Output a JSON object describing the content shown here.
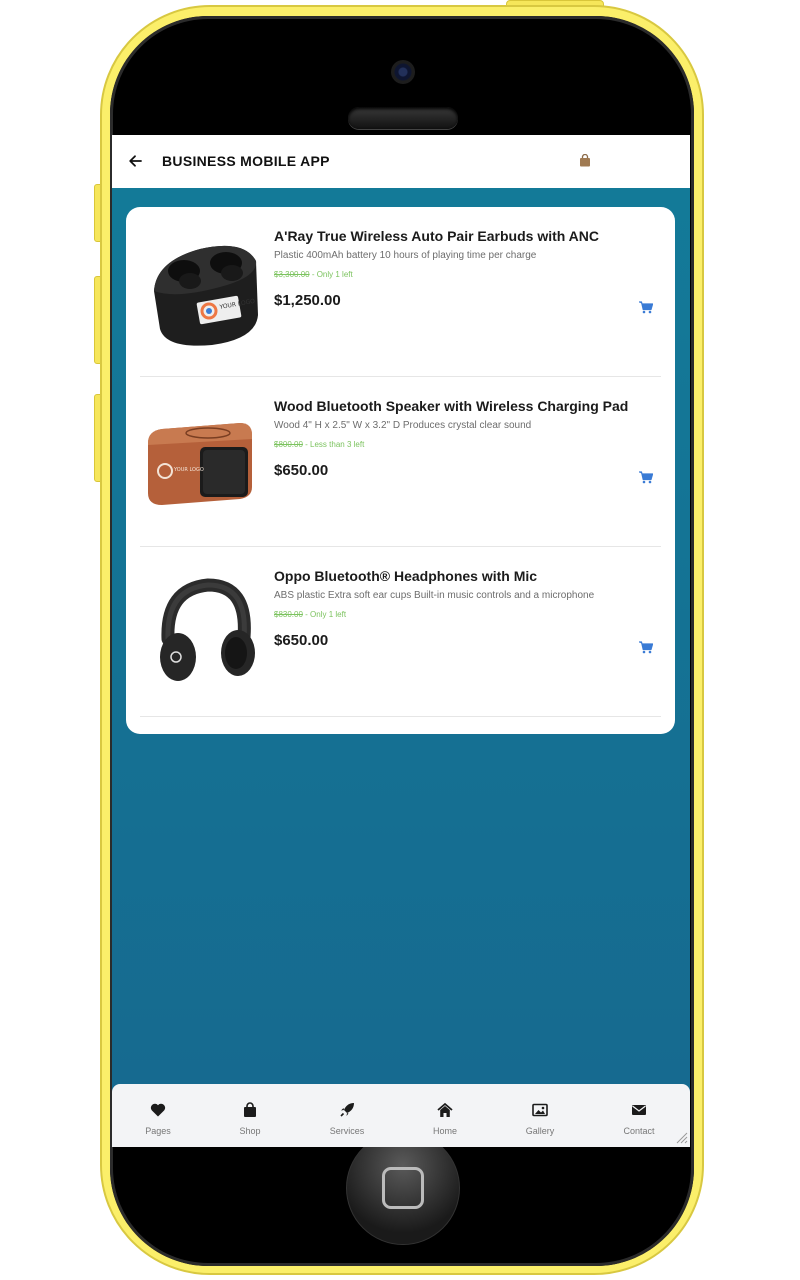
{
  "header": {
    "title": "BUSINESS MOBILE APP",
    "back_icon": "arrow-left-icon",
    "bag_icon": "shopping-bag-icon"
  },
  "products": [
    {
      "name": "A'Ray True Wireless Auto Pair Earbuds with ANC",
      "description": "Plastic 400mAh battery 10 hours of playing time per charge",
      "old_price": "$3,300.00",
      "stock": " - Only 1 left",
      "price": "$1,250.00",
      "image": "earbuds-image",
      "image_logo_text": "YOUR LOGO"
    },
    {
      "name": "Wood Bluetooth Speaker with Wireless Charging Pad",
      "description": "Wood 4\" H x 2.5\" W x 3.2\" D Produces crystal clear sound",
      "old_price": "$800.00",
      "stock": " - Less than 3 left",
      "price": "$650.00",
      "image": "wood-speaker-image",
      "image_logo_text": "YOUR LOGO"
    },
    {
      "name": "Oppo Bluetooth® Headphones with Mic",
      "description": "ABS plastic Extra soft ear cups Built-in music controls and a microphone",
      "old_price": "$830.00",
      "stock": " - Only 1 left",
      "price": "$650.00",
      "image": "headphones-image",
      "image_logo_text": ""
    }
  ],
  "bottom_nav": [
    {
      "label": "Pages",
      "icon": "heart-icon"
    },
    {
      "label": "Shop",
      "icon": "shopping-bag-icon"
    },
    {
      "label": "Services",
      "icon": "rocket-icon"
    },
    {
      "label": "Home",
      "icon": "home-icon"
    },
    {
      "label": "Gallery",
      "icon": "image-icon"
    },
    {
      "label": "Contact",
      "icon": "envelope-icon"
    }
  ],
  "colors": {
    "screen_background": "#137b99",
    "phone_frame": "#fbef6a",
    "cart_icon": "#3a7bd5",
    "stock_text": "#7cc35f",
    "bag_icon": "#8b6b4a"
  }
}
